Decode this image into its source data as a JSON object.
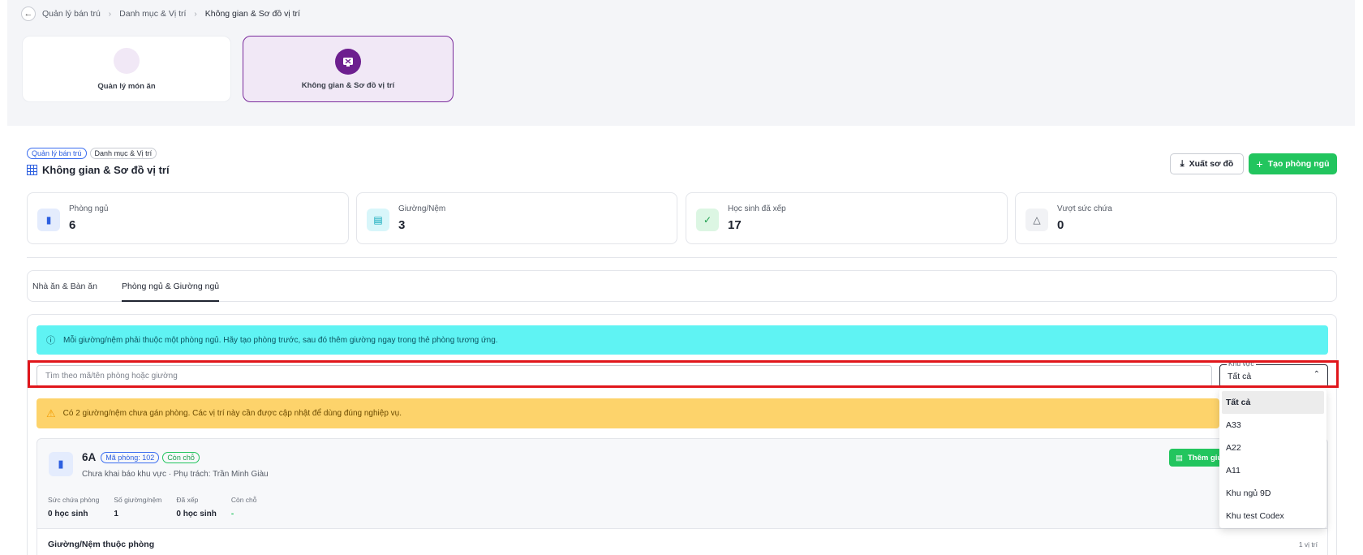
{
  "breadcrumb": {
    "items": [
      "Quản lý bán trú",
      "Danh mục & Vị trí"
    ],
    "current": "Không gian & Sơ đồ vị trí"
  },
  "modules": [
    {
      "label": "Quản lý món ăn",
      "active": false
    },
    {
      "label": "Không gian & Sơ đồ vị trí",
      "active": true
    }
  ],
  "header": {
    "tags": [
      "Quản lý bán trú",
      "Danh mục & Vị trí"
    ],
    "title": "Không gian & Sơ đồ vị trí",
    "export_label": "Xuất sơ đồ",
    "create_label": "Tạo phòng ngủ"
  },
  "stats": [
    {
      "label": "Phòng ngủ",
      "value": "6",
      "icon": "door-icon",
      "color": "#2c5fe0",
      "bg": "#e4ecfd"
    },
    {
      "label": "Giường/Nệm",
      "value": "3",
      "icon": "bed-icon",
      "color": "#0aa6b8",
      "bg": "#d8f6fa"
    },
    {
      "label": "Học sinh đã xếp",
      "value": "17",
      "icon": "user-check-icon",
      "color": "#1a9e4b",
      "bg": "#dcf6e3"
    },
    {
      "label": "Vượt sức chứa",
      "value": "0",
      "icon": "warning-icon",
      "color": "#555b66",
      "bg": "#f1f2f5"
    }
  ],
  "tabs": [
    {
      "label": "Nhà ăn & Bàn ăn",
      "active": false
    },
    {
      "label": "Phòng ngủ & Giường ngủ",
      "active": true
    }
  ],
  "info_banner": "Mỗi giường/nệm phải thuộc một phòng ngủ. Hãy tạo phòng trước, sau đó thêm giường ngay trong thẻ phòng tương ứng.",
  "search": {
    "placeholder": "Tìm theo mã/tên phòng hoặc giường",
    "value": ""
  },
  "area_filter": {
    "label": "Khu vực",
    "value": "Tất cả",
    "options": [
      "Tất cả",
      "A33",
      "A22",
      "A11",
      "Khu ngủ 9D",
      "Khu test Codex"
    ]
  },
  "warn_banner": "Có 2 giường/nệm chưa gán phòng. Các vị trí này cần được cập nhật để dùng đúng nghiệp vụ.",
  "room": {
    "name": "6A",
    "code_badge": "Mã phòng: 102",
    "status_badge": "Còn chỗ",
    "subtitle": "Chưa khai báo khu vực · Phụ trách: Trần Minh Giàu",
    "add_bed_label": "Thêm giường",
    "stats": [
      {
        "label": "Sức chứa phòng",
        "value": "0 học sinh"
      },
      {
        "label": "Số giường/nệm",
        "value": "1"
      },
      {
        "label": "Đã xếp",
        "value": "0 học sinh"
      },
      {
        "label": "Còn chỗ",
        "value": "-"
      }
    ],
    "beds_title": "Giường/Nệm thuộc phòng",
    "beds_count": "1 vị trí"
  },
  "colors": {
    "accent_purple": "#6d1f8f",
    "primary_green": "#22c55e",
    "info_cyan": "#5ff3f3",
    "warning_yellow": "#fdd36b",
    "highlight_red": "#e0161b"
  }
}
